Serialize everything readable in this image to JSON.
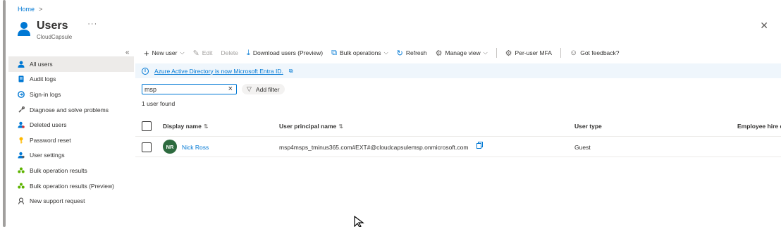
{
  "breadcrumb": {
    "home": "Home",
    "separator": ">"
  },
  "header": {
    "title": "Users",
    "subtitle": "CloudCapsule",
    "more": "···",
    "close": "✕"
  },
  "sidebar": {
    "collapse": "«",
    "items": [
      {
        "label": "All users",
        "icon": "user-icon",
        "active": true
      },
      {
        "label": "Audit logs",
        "icon": "audit-log-icon"
      },
      {
        "label": "Sign-in logs",
        "icon": "sign-in-icon"
      },
      {
        "label": "Diagnose and solve problems",
        "icon": "wrench-icon"
      },
      {
        "label": "Deleted users",
        "icon": "deleted-user-icon"
      },
      {
        "label": "Password reset",
        "icon": "key-icon"
      },
      {
        "label": "User settings",
        "icon": "user-settings-icon"
      },
      {
        "label": "Bulk operation results",
        "icon": "group-icon"
      },
      {
        "label": "Bulk operation results (Preview)",
        "icon": "group-icon"
      },
      {
        "label": "New support request",
        "icon": "support-icon"
      }
    ]
  },
  "toolbar": {
    "new_user": "New user",
    "edit": "Edit",
    "delete": "Delete",
    "download_users": "Download users (Preview)",
    "bulk_operations": "Bulk operations",
    "refresh": "Refresh",
    "manage_view": "Manage view",
    "per_user_mfa": "Per-user MFA",
    "feedback": "Got feedback?"
  },
  "banner": {
    "text": "Azure Active Directory is now Microsoft Entra ID."
  },
  "search": {
    "value": "msp"
  },
  "filter": {
    "add_filter": "Add filter"
  },
  "results": {
    "count_text": "1 user found"
  },
  "table": {
    "columns": [
      "Display name",
      "User principal name",
      "User type",
      "Employee hire d"
    ],
    "sort_glyph": "⇅",
    "rows": [
      {
        "initials": "NR",
        "display_name": "Nick Ross",
        "upn": "msp4msps_tminus365.com#EXT#@cloudcapsulemsp.onmicrosoft.com",
        "user_type": "Guest"
      }
    ]
  },
  "colors": {
    "accent": "#0078d4",
    "avatar": "#2e6b3f",
    "banner_bg": "#eff6fc",
    "active_nav": "#edebe9"
  }
}
